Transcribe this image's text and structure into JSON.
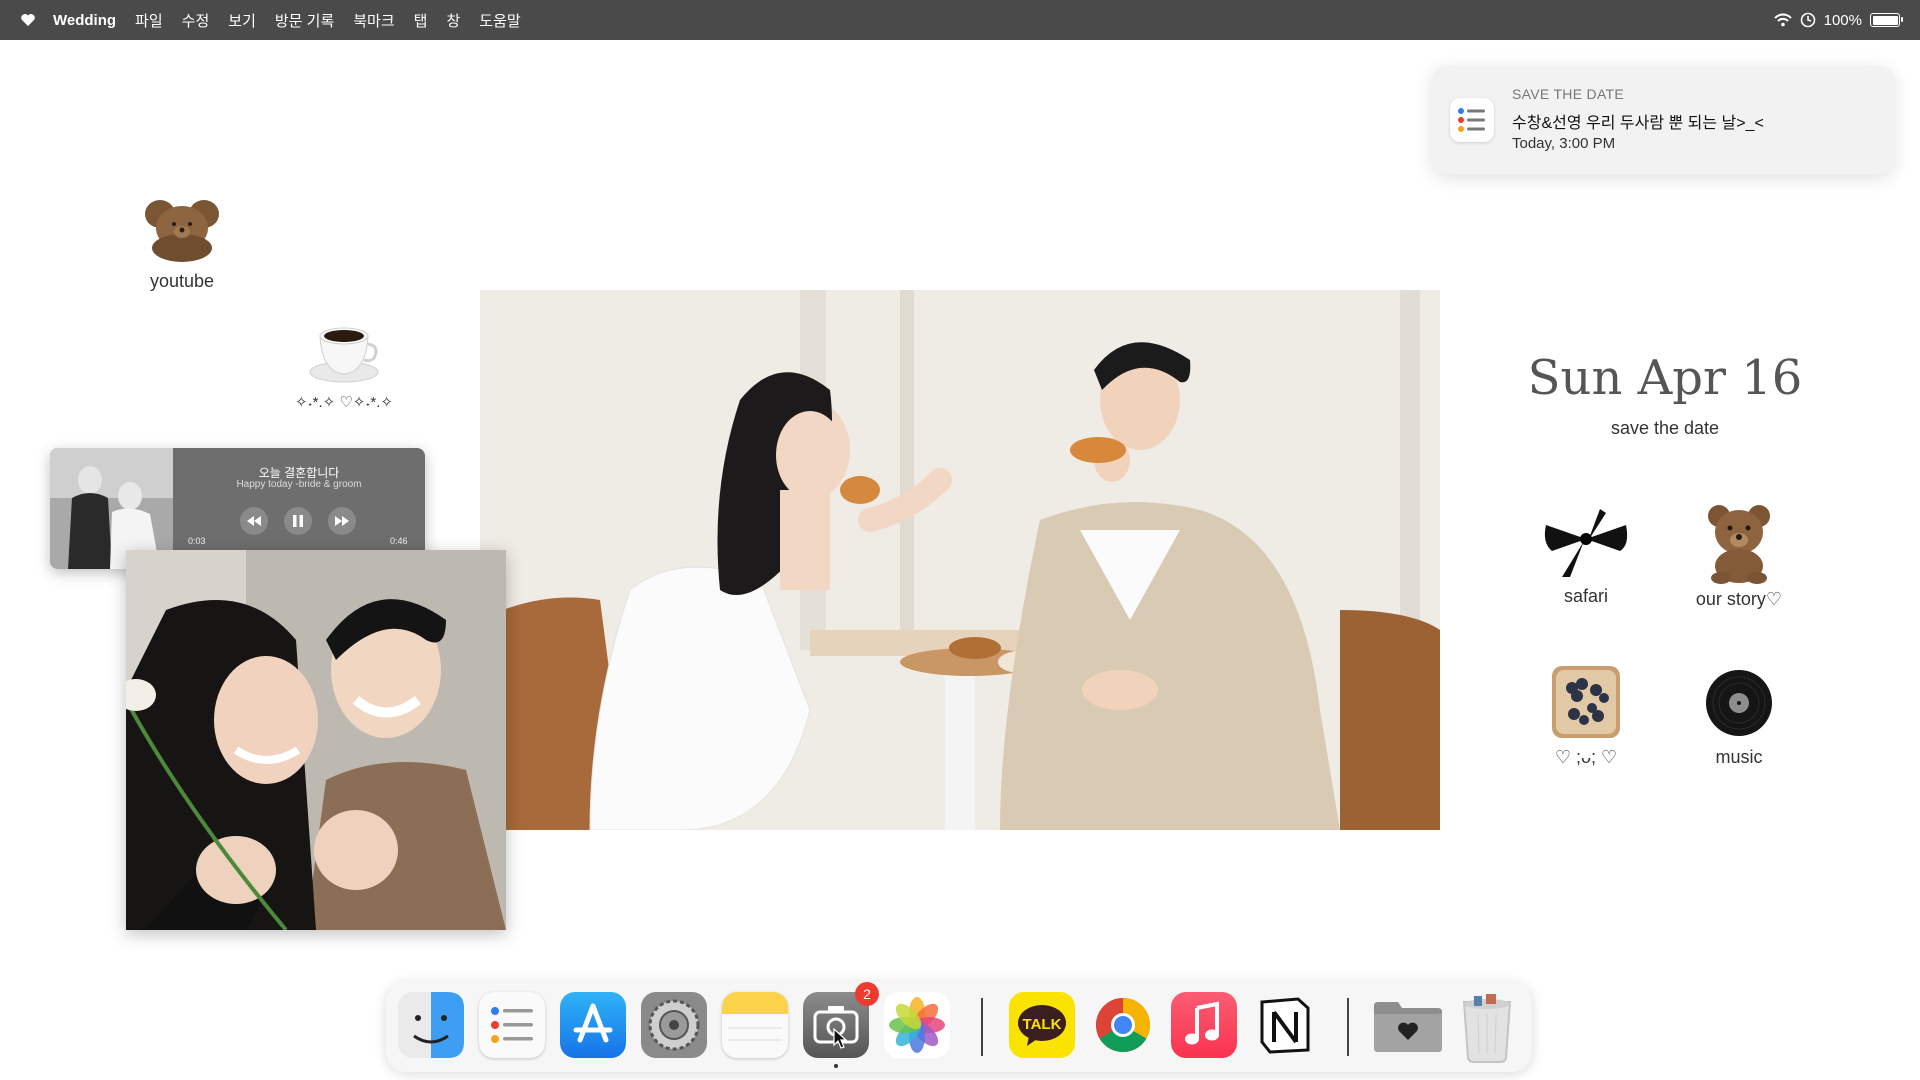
{
  "menubar": {
    "app_name": "Wedding",
    "items": [
      "파일",
      "수정",
      "보기",
      "방문 기록",
      "북마크",
      "탭",
      "창",
      "도움말"
    ],
    "battery": "100%",
    "battery_level": 1.0
  },
  "notification": {
    "app": "SAVE THE DATE",
    "message": "수창&선영 우리 두사람 뿐 되는 날>_<",
    "time": "Today,  3:00 PM"
  },
  "desktop_icons": {
    "youtube": "youtube",
    "coffee": "✧˖*.✧ ♡✧˖*.✧",
    "safari": "safari",
    "our_story": "our story♡",
    "toast": "♡ ;ᴗ; ♡",
    "music": "music"
  },
  "player": {
    "title": "오늘 결혼합니다",
    "subtitle": "Happy today -bride & groom",
    "elapsed": "0:03",
    "duration": "0:46",
    "progress": 0.07
  },
  "date_widget": {
    "date": "Sun Apr 16",
    "caption": "save the date"
  },
  "dock": {
    "camera_badge": "2",
    "kakao_label": "TALK"
  },
  "colors": {
    "menubar": "#4a4a4a",
    "progress": "#3ecb6b",
    "badge": "#ee3b30"
  }
}
